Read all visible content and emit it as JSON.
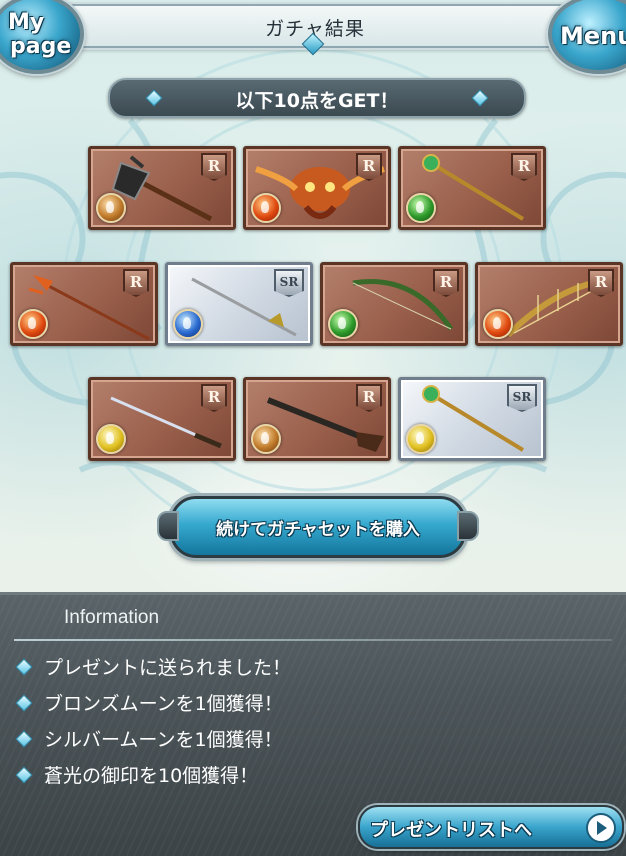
{
  "header": {
    "mypage_line1": "My",
    "mypage_line2": "page",
    "title": "ガチャ結果",
    "menu_label": "Menu"
  },
  "result_banner": {
    "text": "以下10点をGET！"
  },
  "cards": [
    {
      "rarity": "R",
      "element": "earth",
      "item": "axe"
    },
    {
      "rarity": "R",
      "element": "fire",
      "item": "summon"
    },
    {
      "rarity": "R",
      "element": "wind",
      "item": "staff"
    },
    {
      "rarity": "R",
      "element": "fire",
      "item": "spear"
    },
    {
      "rarity": "SR",
      "element": "water",
      "item": "sword"
    },
    {
      "rarity": "R",
      "element": "wind",
      "item": "bow"
    },
    {
      "rarity": "R",
      "element": "fire",
      "item": "harp"
    },
    {
      "rarity": "R",
      "element": "light",
      "item": "katana"
    },
    {
      "rarity": "R",
      "element": "earth",
      "item": "gun"
    },
    {
      "rarity": "SR",
      "element": "light",
      "item": "staff"
    }
  ],
  "buy_button": {
    "label": "続けてガチャセットを購入"
  },
  "information": {
    "heading": "Information",
    "items": [
      "プレゼントに送られました！",
      "ブロンズムーンを1個獲得！",
      "シルバームーンを1個獲得！",
      "蒼光の御印を10個獲得！"
    ]
  },
  "present_button": {
    "label": "プレゼントリストへ"
  },
  "colors": {
    "accent_blue": "#36a9cf",
    "card_r_bronze": "#9a604c",
    "card_sr_silver": "#d5dde6",
    "panel_bg": "#4b5458"
  }
}
